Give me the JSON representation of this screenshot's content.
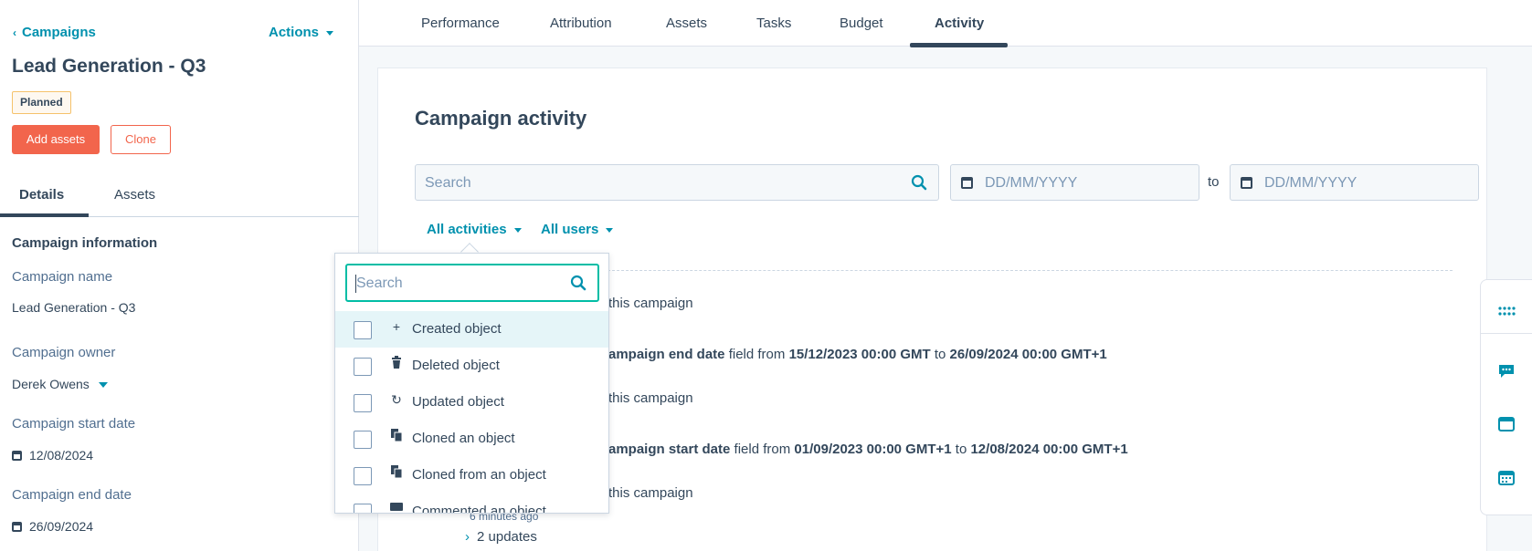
{
  "left": {
    "back_label": "Campaigns",
    "actions_label": "Actions",
    "title": "Lead Generation - Q3",
    "status_badge": "Planned",
    "add_assets": "Add assets",
    "clone": "Clone",
    "tabs": [
      "Details",
      "Assets"
    ],
    "section_title": "Campaign information",
    "fields": {
      "name_label": "Campaign name",
      "name_value": "Lead Generation - Q3",
      "owner_label": "Campaign owner",
      "owner_value": "Derek Owens",
      "start_label": "Campaign start date",
      "start_value": "12/08/2024",
      "end_label": "Campaign end date",
      "end_value": "26/09/2024"
    }
  },
  "topnav": {
    "tabs": [
      "Performance",
      "Attribution",
      "Assets",
      "Tasks",
      "Budget",
      "Activity"
    ],
    "active": "Activity"
  },
  "activity": {
    "title": "Campaign activity",
    "search_placeholder": "Search",
    "date_from_placeholder": "DD/MM/YYYY",
    "to_label": "to",
    "date_to_placeholder": "DD/MM/YYYY",
    "filter_activities": "All activities",
    "filter_users": "All users",
    "feed": {
      "item1": "this campaign",
      "item2_a": "ampaign end date",
      "item2_b": "field from",
      "item2_c": "15/12/2023 00:00 GMT",
      "item2_d": "to",
      "item2_e": "26/09/2024 00:00 GMT+1",
      "item3": "this campaign",
      "item4_a": "ampaign start date",
      "item4_b": "field from",
      "item4_c": "01/09/2023 00:00 GMT+1",
      "item4_d": "to",
      "item4_e": "12/08/2024 00:00 GMT+1",
      "item5": "this campaign",
      "time": "6 minutes ago",
      "updates": "2 updates"
    }
  },
  "dropdown": {
    "search_placeholder": "Search",
    "options": [
      {
        "label": "Created object",
        "icon": "plus-icon",
        "glyph": "+"
      },
      {
        "label": "Deleted object",
        "icon": "trash-icon",
        "glyph": "🗑"
      },
      {
        "label": "Updated object",
        "icon": "refresh-icon",
        "glyph": "↻"
      },
      {
        "label": "Cloned an object",
        "icon": "copy-icon",
        "glyph": "⧉"
      },
      {
        "label": "Cloned from an object",
        "icon": "copy-icon",
        "glyph": "⧉"
      },
      {
        "label": "Commented an object",
        "icon": "comment-icon",
        "glyph": "▬"
      }
    ]
  },
  "colors": {
    "accent": "#0091ae",
    "primary_button": "#f2654c",
    "text": "#33475b",
    "focus": "#00bda5"
  }
}
